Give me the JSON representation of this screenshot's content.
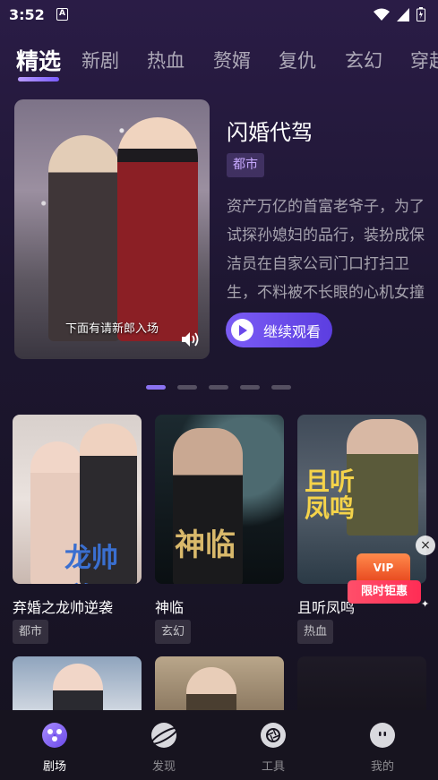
{
  "status": {
    "time": "3:52",
    "notif_letter": "A"
  },
  "tabs": [
    "精选",
    "新剧",
    "热血",
    "赘婿",
    "复仇",
    "玄幻",
    "穿越"
  ],
  "active_tab": 0,
  "hero": {
    "title": "闪婚代驾",
    "tag": "都市",
    "description": "资产万亿的首富老爷子，为了试探孙媳妇的品行，装扮成保洁员在自家公司门口打扫卫生，不料被不长眼的心机女撞倒，心机女不仅不将老爷子…",
    "caption": "下面有请新郎入场",
    "continue_label": "继续观看"
  },
  "carousel": {
    "count": 5,
    "active": 0
  },
  "cards": [
    {
      "title": "弃婚之龙帅逆袭",
      "tag": "都市",
      "poster_text": "龙帅逆"
    },
    {
      "title": "神临",
      "tag": "玄幻",
      "poster_text": "神临"
    },
    {
      "title": "且听凤鸣",
      "tag": "热血",
      "poster_text": "且听凤鸣"
    }
  ],
  "promo": {
    "vip_label": "VIP",
    "label": "限时钜惠",
    "close": "×"
  },
  "nav": [
    {
      "label": "剧场",
      "icon": "theater-icon",
      "active": true
    },
    {
      "label": "发现",
      "icon": "planet-icon",
      "active": false
    },
    {
      "label": "工具",
      "icon": "aperture-icon",
      "active": false
    },
    {
      "label": "我的",
      "icon": "profile-icon",
      "active": false
    }
  ],
  "colors": {
    "accent": "#7b5cf5",
    "tag_text": "#c7a9ff",
    "promo": "#ff2d55"
  }
}
